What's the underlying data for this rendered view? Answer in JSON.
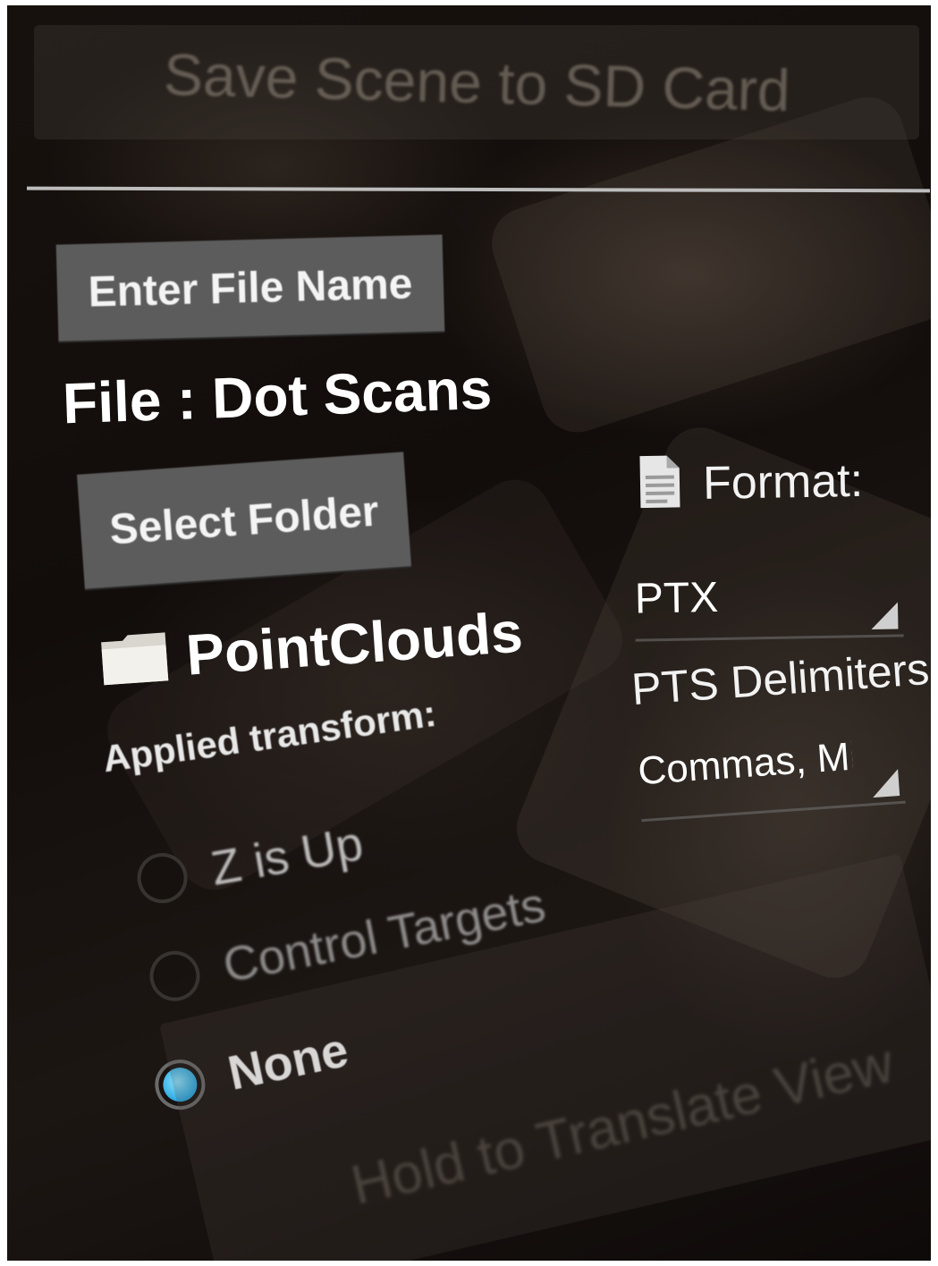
{
  "top_button": {
    "label": "Save Scene to SD Card"
  },
  "file_section": {
    "enter_file_button": "Enter File Name",
    "file_label": "File : Dot Scans",
    "select_folder_button": "Select Folder",
    "folder_icon": "folder-icon",
    "folder_name": "PointClouds"
  },
  "transform": {
    "label": "Applied transform:",
    "options": [
      {
        "label": "Z is Up",
        "checked": false
      },
      {
        "label": "Control Targets",
        "checked": false
      },
      {
        "label": "None",
        "checked": true
      }
    ]
  },
  "format": {
    "icon": "document-icon",
    "label": "Format:",
    "selected": "PTX"
  },
  "delimiters": {
    "label": "PTS Delimiters:",
    "selected": "Commas, Mi"
  },
  "bottom_button": {
    "label": "Hold to Translate View"
  },
  "colors": {
    "radio_selected": "#2aa7e0",
    "button_bg": "#5c5c5c",
    "text": "#ffffff"
  }
}
